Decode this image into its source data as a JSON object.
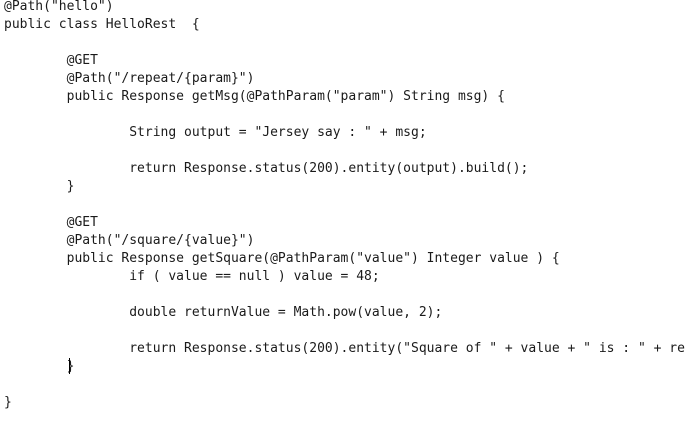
{
  "editor": {
    "lines": [
      "@Path(\"hello\")",
      "public class HelloRest  {",
      "",
      "        @GET",
      "        @Path(\"/repeat/{param}\")",
      "        public Response getMsg(@PathParam(\"param\") String msg) {",
      "",
      "                String output = \"Jersey say : \" + msg;",
      "",
      "                return Response.status(200).entity(output).build();",
      "        }",
      "",
      "        @GET",
      "        @Path(\"/square/{value}\")",
      "        public Response getSquare(@PathParam(\"value\") Integer value ) {",
      "                if ( value == null ) value = 48;",
      "",
      "                double returnValue = Math.pow(value, 2);",
      "",
      "                return Response.status(200).entity(\"Square of \" + value + \" is : \" + re",
      "        }",
      "",
      "}"
    ]
  }
}
